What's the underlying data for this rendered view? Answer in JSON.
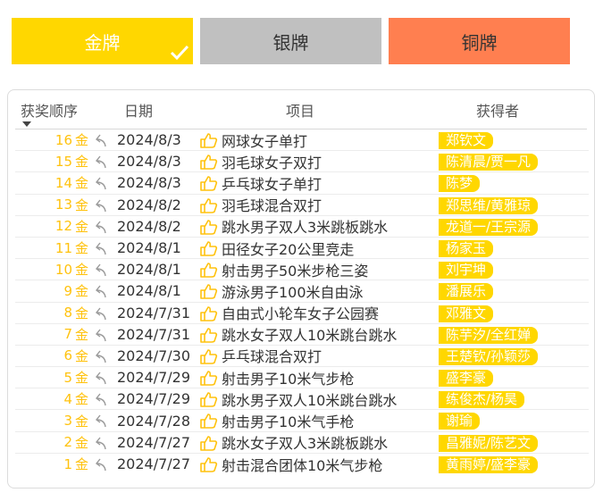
{
  "tabs": {
    "gold": "金牌",
    "silver": "银牌",
    "bronze": "铜牌"
  },
  "headers": {
    "order": "获奖顺序",
    "date": "日期",
    "event": "项目",
    "winner": "获得者"
  },
  "colors": {
    "gold": "#FFD700",
    "silver": "#C0C0C0",
    "bronze": "#FF7F50",
    "medal_text": "#FFC20E"
  },
  "medal_label": "金",
  "rows": [
    {
      "n": "16",
      "date": "2024/8/3",
      "event": "网球女子单打",
      "winner": "郑钦文"
    },
    {
      "n": "15",
      "date": "2024/8/3",
      "event": "羽毛球女子双打",
      "winner": "陈清晨/贾一凡"
    },
    {
      "n": "14",
      "date": "2024/8/3",
      "event": "乒乓球女子单打",
      "winner": "陈梦"
    },
    {
      "n": "13",
      "date": "2024/8/2",
      "event": "羽毛球混合双打",
      "winner": "郑思维/黄雅琼"
    },
    {
      "n": "12",
      "date": "2024/8/2",
      "event": "跳水男子双人3米跳板跳水",
      "winner": "龙道一/王宗源"
    },
    {
      "n": "11",
      "date": "2024/8/1",
      "event": "田径女子20公里竞走",
      "winner": "杨家玉"
    },
    {
      "n": "10",
      "date": "2024/8/1",
      "event": "射击男子50米步枪三姿",
      "winner": "刘宇坤"
    },
    {
      "n": "9",
      "date": "2024/8/1",
      "event": "游泳男子100米自由泳",
      "winner": "潘展乐"
    },
    {
      "n": "8",
      "date": "2024/7/31",
      "event": "自由式小轮车女子公园赛",
      "winner": "邓雅文"
    },
    {
      "n": "7",
      "date": "2024/7/31",
      "event": "跳水女子双人10米跳台跳水",
      "winner": "陈芋汐/全红婵"
    },
    {
      "n": "6",
      "date": "2024/7/30",
      "event": "乒乓球混合双打",
      "winner": "王楚钦/孙颖莎"
    },
    {
      "n": "5",
      "date": "2024/7/29",
      "event": "射击男子10米气步枪",
      "winner": "盛李豪"
    },
    {
      "n": "4",
      "date": "2024/7/29",
      "event": "跳水男子双人10米跳台跳水",
      "winner": "练俊杰/杨昊"
    },
    {
      "n": "3",
      "date": "2024/7/28",
      "event": "射击男子10米气手枪",
      "winner": "谢瑜"
    },
    {
      "n": "2",
      "date": "2024/7/27",
      "event": "跳水女子双人3米跳板跳水",
      "winner": "昌雅妮/陈艺文"
    },
    {
      "n": "1",
      "date": "2024/7/27",
      "event": "射击混合团体10米气步枪",
      "winner": "黄雨婷/盛李豪"
    }
  ]
}
